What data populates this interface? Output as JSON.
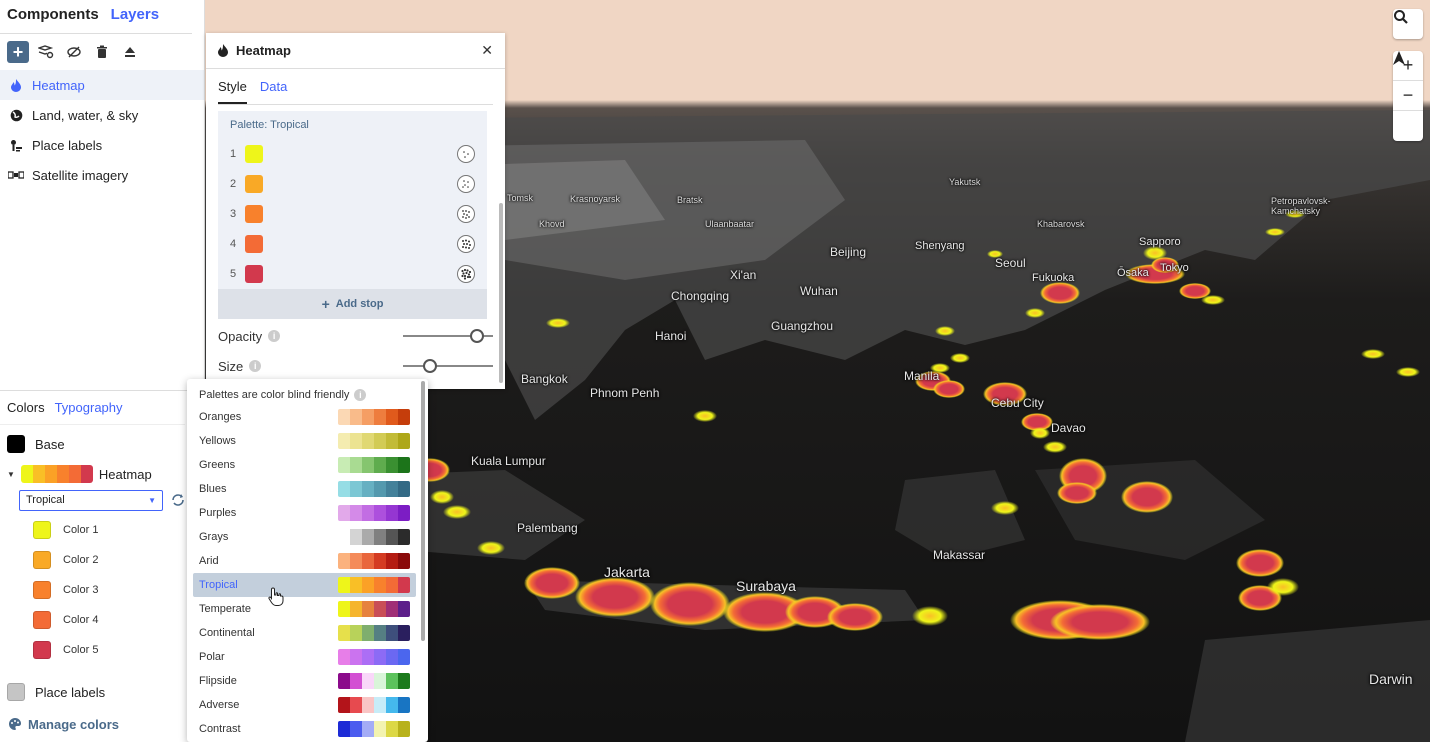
{
  "left_panel": {
    "tabs": [
      "Components",
      "Layers"
    ],
    "components": [
      {
        "label": "Heatmap",
        "icon": "flame-icon"
      },
      {
        "label": "Land, water, & sky",
        "icon": "globe-icon"
      },
      {
        "label": "Place labels",
        "icon": "place-label-icon"
      },
      {
        "label": "Satellite imagery",
        "icon": "satellite-icon"
      }
    ],
    "bottom_tabs": [
      "Colors",
      "Typography"
    ],
    "base_label": "Base",
    "heatmap_label": "Heatmap",
    "palette_select": "Tropical",
    "color_labels": [
      "Color 1",
      "Color 2",
      "Color 3",
      "Color 4",
      "Color 5"
    ],
    "place_labels": "Place labels",
    "manage_colors": "Manage colors"
  },
  "heatmap_panel": {
    "title": "Heatmap",
    "tabs": [
      "Style",
      "Data"
    ],
    "palette_title": "Palette: Tropical",
    "stop_numbers": [
      "1",
      "2",
      "3",
      "4",
      "5"
    ],
    "add_stop": "Add stop",
    "opacity_label": "Opacity",
    "size_label": "Size",
    "opacity_level": 0.82,
    "size_level": 0.3
  },
  "palette_dropdown": {
    "header": "Palettes are color blind friendly",
    "palettes": [
      {
        "name": "Oranges",
        "colors": [
          "#fbd8b4",
          "#f9bb8a",
          "#f59e64",
          "#ee7d3e",
          "#e05a1c",
          "#c53d0b"
        ]
      },
      {
        "name": "Yellows",
        "colors": [
          "#f4ecb0",
          "#ece391",
          "#e0d873",
          "#d2cb55",
          "#c2bb37",
          "#aea719"
        ]
      },
      {
        "name": "Greens",
        "colors": [
          "#c8ecb4",
          "#a9db92",
          "#85c56f",
          "#5fac4e",
          "#3a9031",
          "#1c741a"
        ]
      },
      {
        "name": "Blues",
        "colors": [
          "#96dde5",
          "#7cc7d4",
          "#66b0c2",
          "#5499ae",
          "#43819a",
          "#336a85"
        ]
      },
      {
        "name": "Purples",
        "colors": [
          "#e2a9ea",
          "#d48ae8",
          "#c26de3",
          "#ad50dd",
          "#9536d2",
          "#7c1dc4"
        ]
      },
      {
        "name": "Grays",
        "colors": [
          "#ffffff",
          "#d4d4d4",
          "#aaaaaa",
          "#808080",
          "#555555",
          "#2b2b2b"
        ]
      },
      {
        "name": "Arid",
        "colors": [
          "#fbb27e",
          "#f48b5a",
          "#e9663c",
          "#d43b22",
          "#b41c12",
          "#8b0a0a"
        ]
      },
      {
        "name": "Tropical",
        "colors": [
          "#eef51a",
          "#f9bf26",
          "#fba126",
          "#f8812c",
          "#f36b36",
          "#d2394d"
        ]
      },
      {
        "name": "Temperate",
        "colors": [
          "#eef51a",
          "#f5b52e",
          "#e6823e",
          "#c94e57",
          "#a02f76",
          "#5d1f8a"
        ]
      },
      {
        "name": "Continental",
        "colors": [
          "#e6e04b",
          "#b8d25a",
          "#7fae6e",
          "#557f83",
          "#3e4f7c",
          "#2a1f5e"
        ]
      },
      {
        "name": "Polar",
        "colors": [
          "#e77ee8",
          "#cb73ef",
          "#ac6ef5",
          "#8c6bf5",
          "#6b68f2",
          "#4b66ee"
        ]
      },
      {
        "name": "Flipside",
        "colors": [
          "#8b0a8b",
          "#d34fd3",
          "#f9d7f9",
          "#d9f5d9",
          "#5cc25c",
          "#1c7a1c"
        ]
      },
      {
        "name": "Adverse",
        "colors": [
          "#b3141a",
          "#e74a4f",
          "#f9c5c5",
          "#c7ecf8",
          "#45b9ed",
          "#1875c3"
        ]
      },
      {
        "name": "Contrast",
        "colors": [
          "#1d2bd6",
          "#4b5cef",
          "#a4acf6",
          "#f3f3b0",
          "#dcd846",
          "#b8b21c"
        ]
      }
    ],
    "selected": "Tropical"
  },
  "tropical_colors": [
    "#eef51a",
    "#f9a926",
    "#f8812c",
    "#f36b36",
    "#d2394d"
  ],
  "base_color": "#000000",
  "place_labels_color": "#c5c5c5",
  "map": {
    "cities": [
      {
        "name": "Tomsk",
        "size": "small"
      },
      {
        "name": "Krasnoyarsk",
        "size": "small"
      },
      {
        "name": "Bratsk",
        "size": "small"
      },
      {
        "name": "Yakutsk",
        "size": "small"
      },
      {
        "name": "Petropavlovsk-Kamchatsky",
        "size": "small"
      },
      {
        "name": "Khovd",
        "size": "small"
      },
      {
        "name": "Ulaanbaatar",
        "size": "small"
      },
      {
        "name": "Khabarovsk",
        "size": "small"
      },
      {
        "name": "Beijing",
        "size": "med"
      },
      {
        "name": "Shenyang",
        "size": "med"
      },
      {
        "name": "Sapporo",
        "size": "med"
      },
      {
        "name": "Seoul",
        "size": "med"
      },
      {
        "name": "Xi'an",
        "size": "med"
      },
      {
        "name": "Fukuoka",
        "size": "med"
      },
      {
        "name": "Ōsaka",
        "size": "med"
      },
      {
        "name": "Tokyo",
        "size": "med"
      },
      {
        "name": "Chongqing",
        "size": "med"
      },
      {
        "name": "Wuhan",
        "size": "med"
      },
      {
        "name": "Guangzhou",
        "size": "med"
      },
      {
        "name": "Hanoi",
        "size": "med"
      },
      {
        "name": "Manila",
        "size": "med"
      },
      {
        "name": "Bangkok",
        "size": "med"
      },
      {
        "name": "Phnom Penh",
        "size": "med"
      },
      {
        "name": "Cebu City",
        "size": "med"
      },
      {
        "name": "Davao",
        "size": "med"
      },
      {
        "name": "Kuala Lumpur",
        "size": "med"
      },
      {
        "name": "Palembang",
        "size": "med"
      },
      {
        "name": "Makassar",
        "size": "med"
      },
      {
        "name": "Jakarta",
        "size": "big"
      },
      {
        "name": "Surabaya",
        "size": "big"
      },
      {
        "name": "Darwin",
        "size": "big"
      }
    ]
  }
}
